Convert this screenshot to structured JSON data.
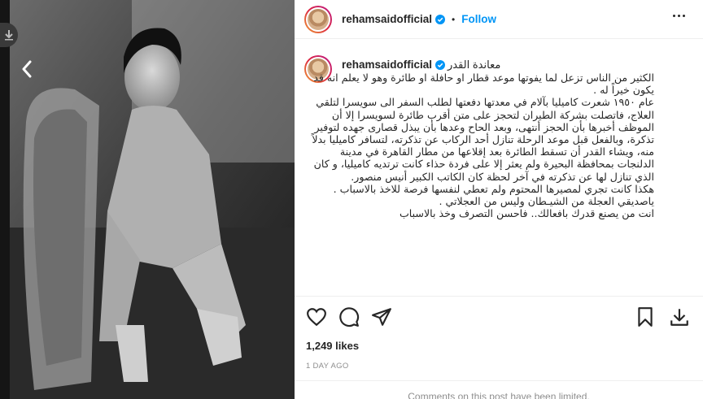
{
  "post": {
    "username": "rehamsaidofficial",
    "follow_label": "Follow",
    "dot": "•",
    "caption_title": "معاندة القدر",
    "caption_body": "الكثير من الناس تزعل لما يفوتها موعد قطار او حافلة او طائرة وهو لا يعلم انه قد يكون خيراً له .\nعام ١٩٥٠ شعرت كاميليا بآلام في معدتها دفعتها لطلب السفر الى سويسرا لتلقي العلاج، فاتصلت بشركة الطيران لتحجز على متن أقرب طائرة لسويسرا إلا أن الموظف أخبرها بأن الحجز أنتهى، وبعد الحاح وعدها بأن يبذل قصارى جهده لتوفير تذكرة، وبالفعل قبل موعد الرحلة تنازل أحد الركاب عن تذكرته، لتسافر كاميليا بدلاً منه، ويشاء القدر أن تسقط الطائرة بعد إقلاعها من مطار القاهرة في مدينة الدلنجات بمحافظة البحيرة ولم يعثر إلا على فردة حذاء كانت ترتديه كاميليا، و كان الذي تنازل لها عن تذكرته في آخر لحظة كان الكاتب الكبير أنيس منصور.\nهكذا كانت تجري لمصيرها المحتوم ولم تعطي لنفسها فرصة للاخذ بالاسباب .\nياصديقي العجلة من الشيـطان وليس من العجلاتي .\nانت من يصنع قدرك بافعالك.. فاحسن التصرف وخذ بالاسباب",
    "likes": "1,249 likes",
    "time_ago": "1 DAY AGO",
    "comments_notice": "Comments on this post have been limited."
  },
  "icons": {
    "like": "heart-icon",
    "comment": "comment-icon",
    "share": "share-icon",
    "save": "bookmark-icon",
    "download": "download-icon",
    "more": "more-options-icon",
    "verified": "verified-badge-icon",
    "prev": "chevron-left-icon"
  },
  "colors": {
    "accent": "#0095f6",
    "text": "#262626",
    "muted": "#8e8e8e"
  }
}
